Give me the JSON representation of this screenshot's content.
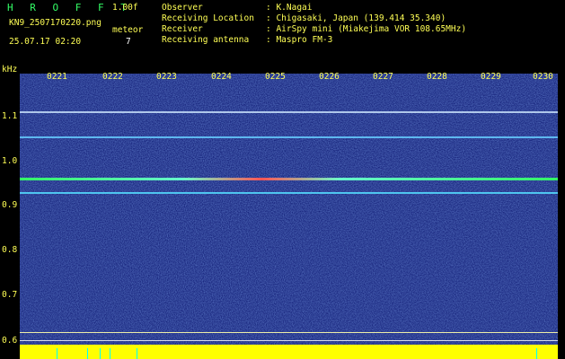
{
  "header": {
    "logo": "H R O F F T",
    "version": "1.00f",
    "filename": "KN9_2507170220.png",
    "meteor_label": "meteor",
    "meteor_count": "7",
    "datetime": "25.07.17 02:20",
    "info_keys": [
      "Observer",
      "Receiving Location",
      "Receiver",
      "Receiving antenna"
    ],
    "info_values": [
      ": K.Nagai",
      ": Chigasaki, Japan (139.414 35.340)",
      ": AirSpy mini (Miakejima VOR 108.65MHz)",
      ": Maspro FM-3"
    ]
  },
  "axis": {
    "unit": "kHz",
    "y_ticks": [
      "1.1",
      "1.0",
      "0.9",
      "0.8",
      "0.7",
      "0.6"
    ],
    "time_ticks": [
      "0221",
      "0222",
      "0223",
      "0224",
      "0225",
      "0226",
      "0227",
      "0228",
      "0229",
      "0230"
    ]
  },
  "colors": {
    "background_blue": "#1a2a8c",
    "carrier_red": "#ff3333",
    "signal_green": "#33ff66",
    "axis_yellow": "#ffff55",
    "footer_yellow": "#ffff00"
  }
}
